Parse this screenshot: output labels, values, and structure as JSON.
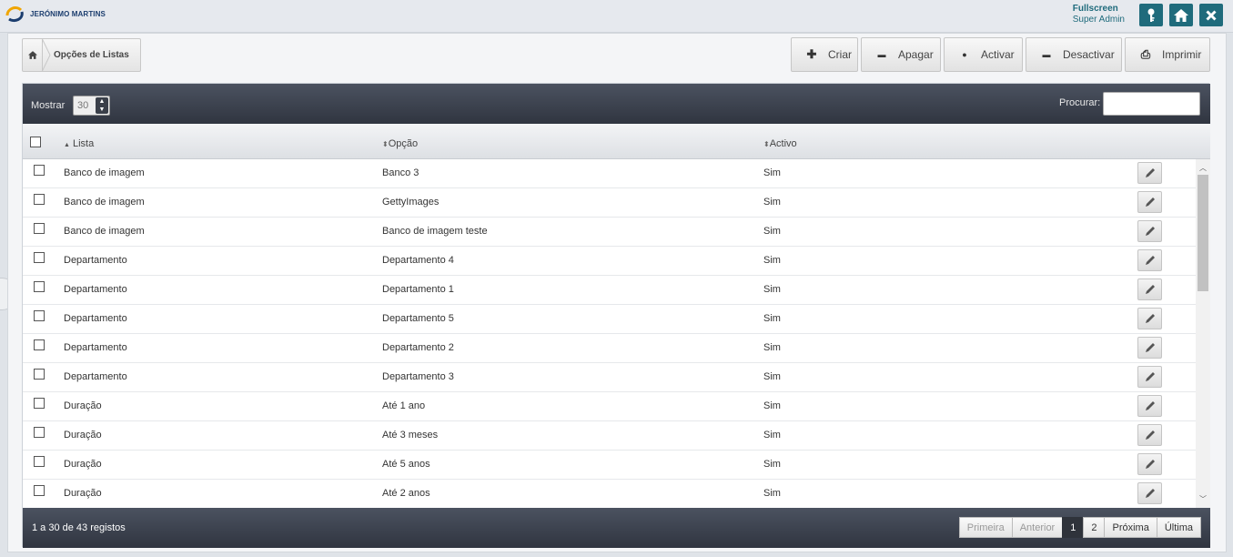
{
  "header": {
    "logo_text": "JERÓNIMO MARTINS",
    "mode": "Fullscreen",
    "role": "Super Admin",
    "buttons": [
      {
        "name": "key-icon"
      },
      {
        "name": "home-icon"
      },
      {
        "name": "close-icon"
      }
    ],
    "accent": "#1f6b7c"
  },
  "breadcrumb": {
    "home_icon": "home-icon",
    "label": "Opções de Listas"
  },
  "actions": [
    {
      "label": "Criar",
      "icon": "plus-icon",
      "glyph": "✚"
    },
    {
      "label": "Apagar",
      "icon": "minus-icon",
      "glyph": "▬"
    },
    {
      "label": "Activar",
      "icon": "dot-icon",
      "glyph": "●"
    },
    {
      "label": "Desactivar",
      "icon": "minus-icon",
      "glyph": "▬"
    },
    {
      "label": "Imprimir",
      "icon": "print-icon",
      "glyph": "⎙"
    }
  ],
  "table": {
    "show_label": "Mostrar",
    "page_size": "30",
    "search_label": "Procurar:",
    "search_value": "",
    "columns": [
      "Lista",
      "Opção",
      "Activo"
    ],
    "rows": [
      {
        "lista": "Banco de imagem",
        "opcao": "Banco 3",
        "activo": "Sim"
      },
      {
        "lista": "Banco de imagem",
        "opcao": "GettyImages",
        "activo": "Sim"
      },
      {
        "lista": "Banco de imagem",
        "opcao": "Banco de imagem teste",
        "activo": "Sim"
      },
      {
        "lista": "Departamento",
        "opcao": "Departamento 4",
        "activo": "Sim"
      },
      {
        "lista": "Departamento",
        "opcao": "Departamento 1",
        "activo": "Sim"
      },
      {
        "lista": "Departamento",
        "opcao": "Departamento 5",
        "activo": "Sim"
      },
      {
        "lista": "Departamento",
        "opcao": "Departamento 2",
        "activo": "Sim"
      },
      {
        "lista": "Departamento",
        "opcao": "Departamento 3",
        "activo": "Sim"
      },
      {
        "lista": "Duração",
        "opcao": "Até 1 ano",
        "activo": "Sim"
      },
      {
        "lista": "Duração",
        "opcao": "Até 3 meses",
        "activo": "Sim"
      },
      {
        "lista": "Duração",
        "opcao": "Até 5 anos",
        "activo": "Sim"
      },
      {
        "lista": "Duração",
        "opcao": "Até 2 anos",
        "activo": "Sim"
      }
    ],
    "info": "1 a 30 de 43 registos",
    "pagination": [
      {
        "label": "Primeira",
        "state": "disabled"
      },
      {
        "label": "Anterior",
        "state": "disabled"
      },
      {
        "label": "1",
        "state": "current"
      },
      {
        "label": "2",
        "state": "normal"
      },
      {
        "label": "Próxima",
        "state": "normal"
      },
      {
        "label": "Última",
        "state": "normal"
      }
    ]
  }
}
